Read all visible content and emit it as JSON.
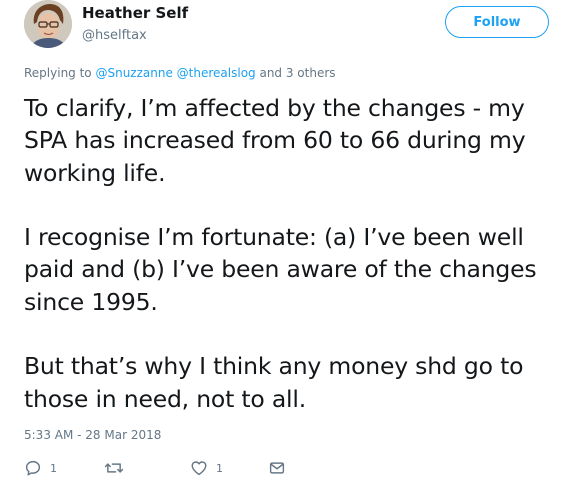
{
  "author": {
    "display_name": "Heather Self",
    "handle": "@hselftax"
  },
  "follow_label": "Follow",
  "reply_context": {
    "prefix": "Replying to ",
    "mentions": [
      "@Snuzzanne",
      "@therealslog"
    ],
    "suffix": " and 3 others"
  },
  "tweet": {
    "paragraphs": [
      "To clarify, I’m affected by the changes - my\nSPA has increased from 60 to 66 during my\nworking life.",
      "I recognise I’m fortunate: (a) I’ve been well\npaid and (b) I’ve been aware of the changes\nsince 1995.",
      "But that’s why I think any money shd go to\nthose in need, not to all."
    ],
    "timestamp": "5:33 AM - 28 Mar 2018"
  },
  "actions": {
    "reply": {
      "icon": "reply-icon",
      "count": "1"
    },
    "retweet": {
      "icon": "retweet-icon",
      "count": ""
    },
    "like": {
      "icon": "heart-icon",
      "count": "1"
    },
    "message": {
      "icon": "envelope-icon"
    }
  },
  "colors": {
    "accent": "#1da1f2",
    "text": "#14171a",
    "secondary": "#657786"
  }
}
